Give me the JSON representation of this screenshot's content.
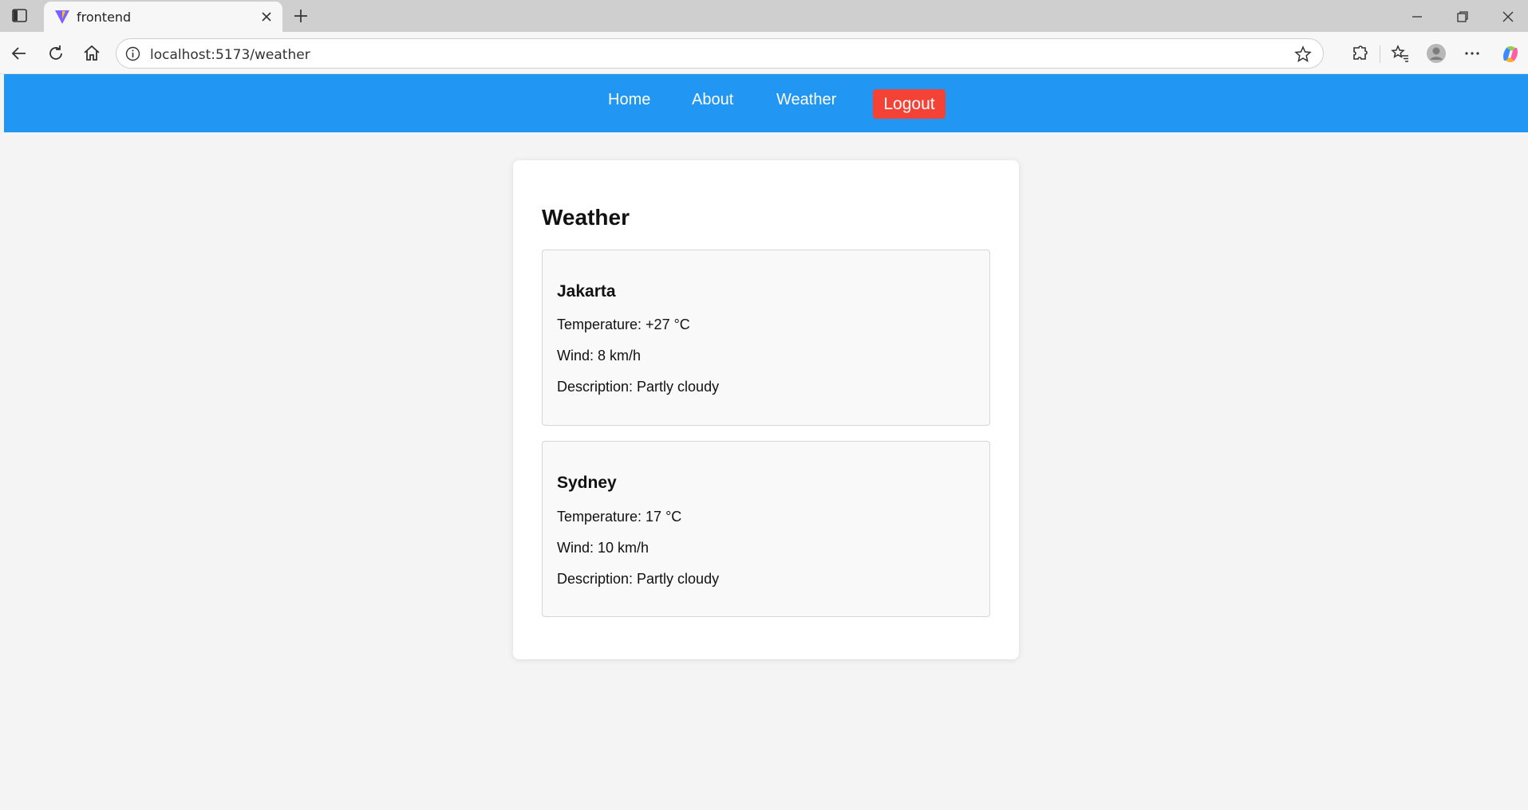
{
  "browser": {
    "tab_title": "frontend",
    "url": "localhost:5173/weather"
  },
  "nav": {
    "home": "Home",
    "about": "About",
    "weather": "Weather",
    "logout": "Logout"
  },
  "page": {
    "title": "Weather",
    "cities": [
      {
        "name": "Jakarta",
        "temperature": "Temperature: +27 °C",
        "wind": "Wind: 8 km/h",
        "description": "Description: Partly cloudy"
      },
      {
        "name": "Sydney",
        "temperature": "Temperature: 17 °C",
        "wind": "Wind: 10 km/h",
        "description": "Description: Partly cloudy"
      }
    ]
  },
  "colors": {
    "navbar": "#2196f3",
    "logout": "#f44336",
    "page_bg": "#f4f4f4",
    "card_bg": "#ffffff",
    "city_bg": "#f9f9f9"
  },
  "icons": [
    "sidebar-icon",
    "vite-favicon-icon",
    "close-icon",
    "plus-icon",
    "minimize-icon",
    "restore-icon",
    "window-close-icon",
    "back-icon",
    "refresh-icon",
    "home-icon",
    "info-icon",
    "star-icon",
    "extensions-icon",
    "favorites-icon",
    "profile-icon",
    "more-icon",
    "copilot-icon"
  ]
}
